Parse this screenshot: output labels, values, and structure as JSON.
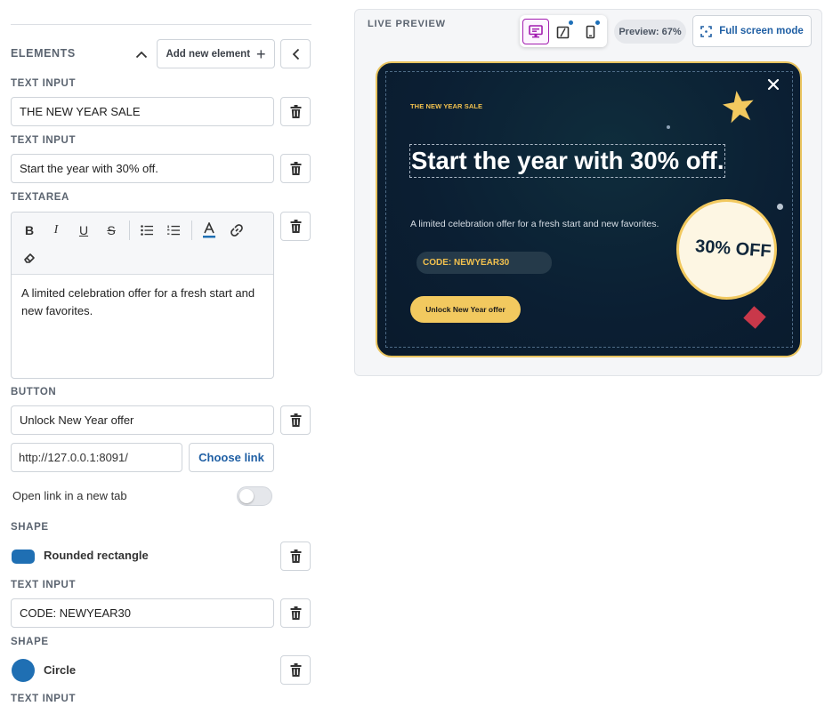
{
  "editor": {
    "elements_title": "ELEMENTS",
    "add_button": "Add new element",
    "blocks": {
      "text1": {
        "type": "TEXT INPUT",
        "value": "THE NEW YEAR SALE"
      },
      "text2": {
        "type": "TEXT INPUT",
        "value": "Start the year with 30% off."
      },
      "textarea": {
        "type": "TEXTAREA",
        "value": "A limited celebration offer for a fresh start and new favorites."
      },
      "button": {
        "type": "BUTTON",
        "label": "Unlock New Year offer",
        "url": "http://127.0.0.1:8091/",
        "choose_link": "Choose link",
        "new_tab_label": "Open link in a new tab",
        "new_tab_enabled": false
      },
      "shape1": {
        "type": "SHAPE",
        "name": "Rounded rectangle",
        "color": "#1f6fb3"
      },
      "text3": {
        "type": "TEXT INPUT",
        "value": "CODE: NEWYEAR30"
      },
      "shape2": {
        "type": "SHAPE",
        "name": "Circle",
        "color": "#1f6fb3"
      },
      "text4": {
        "type": "TEXT INPUT"
      }
    },
    "toolbar": {
      "bold": "B",
      "italic": "I",
      "underline": "U",
      "strike": "S",
      "icons": [
        "bold-icon",
        "italic-icon",
        "underline-icon",
        "strikethrough-icon",
        "bullet-list-icon",
        "numbered-list-icon",
        "text-color-icon",
        "link-icon",
        "clear-format-icon"
      ]
    }
  },
  "preview": {
    "title": "LIVE PREVIEW",
    "zoom": "Preview: 67%",
    "fullscreen": "Full screen mode",
    "devices": [
      "desktop-icon",
      "tablet-icon",
      "mobile-icon"
    ],
    "active_device": "desktop",
    "banner": {
      "eyebrow": "THE NEW YEAR SALE",
      "headline": "Start the year with 30% off.",
      "description": "A limited celebration offer for a fresh start and new favorites.",
      "code": "CODE: NEWYEAR30",
      "cta": "Unlock New Year offer",
      "badge": "30% OFF",
      "colors": {
        "background": "#0b1f33",
        "accent": "#f2c95f",
        "diamond": "#c9384a"
      }
    }
  },
  "colors": {
    "link_blue": "#1f5fa4",
    "active_purple": "#a21caf",
    "border": "#cfd4da"
  }
}
